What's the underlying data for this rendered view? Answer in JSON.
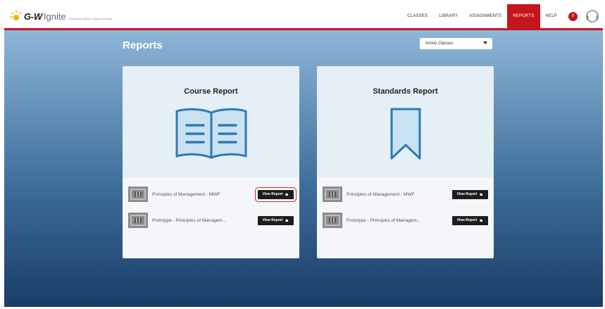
{
  "header": {
    "logo_brand_g": "G-W",
    "logo_brand_rest": "Ignite",
    "logo_tagline": "Goodheart-Willcox Digital Learning",
    "nav": [
      {
        "label": "CLASSES"
      },
      {
        "label": "LIBRARY"
      },
      {
        "label": "ASSIGNMENTS"
      },
      {
        "label": "REPORTS",
        "active": true
      },
      {
        "label": "HELP"
      }
    ],
    "notification_count": "0"
  },
  "page": {
    "title": "Reports",
    "filter_selected": "Active Classes"
  },
  "cards": [
    {
      "title": "Course Report",
      "rows": [
        {
          "label": "Principles of Management - MWF",
          "button": "View Report"
        },
        {
          "label": "Prototype - Principles of Managem...",
          "button": "View Report"
        }
      ]
    },
    {
      "title": "Standards Report",
      "rows": [
        {
          "label": "Principles of Management - MWF",
          "button": "View Report"
        },
        {
          "label": "Prototype - Principles of Managem...",
          "button": "View Report"
        }
      ]
    }
  ],
  "colors": {
    "brand_red": "#c4161c",
    "illustration": "#2f79b5",
    "illustration_fill": "#c9e2f2"
  }
}
